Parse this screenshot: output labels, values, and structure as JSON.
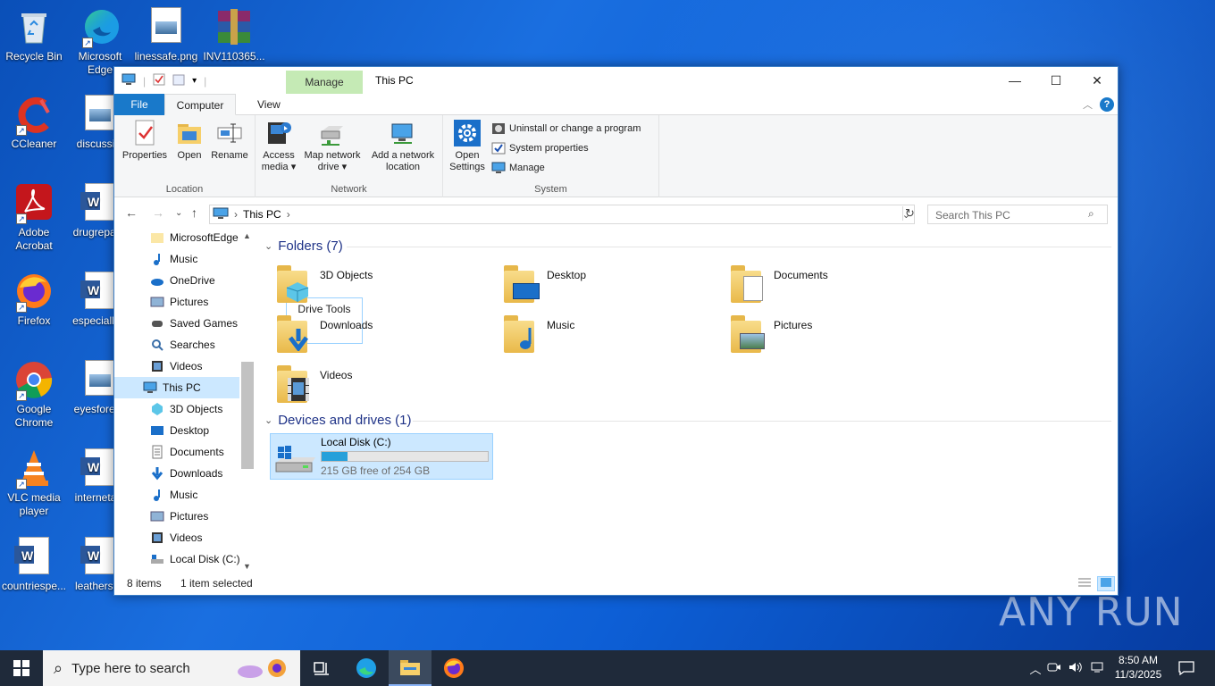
{
  "desktop": {
    "icons": [
      {
        "label": "Recycle Bin"
      },
      {
        "label": "Microsoft Edge"
      },
      {
        "label": "linessafe.png"
      },
      {
        "label": "INV110365..."
      },
      {
        "label": "CCleaner"
      },
      {
        "label": "discussi..."
      },
      {
        "label": "Adobe Acrobat"
      },
      {
        "label": "drugrepai..."
      },
      {
        "label": "Firefox"
      },
      {
        "label": "especially..."
      },
      {
        "label": "Google Chrome"
      },
      {
        "label": "eyesforei..."
      },
      {
        "label": "VLC media player"
      },
      {
        "label": "interneta..."
      },
      {
        "label": "countriespe..."
      },
      {
        "label": "leatherst..."
      }
    ],
    "watermark": "ANY RUN"
  },
  "window": {
    "title": "This PC",
    "contextual_tab": "Manage",
    "controls": {
      "minimize": "—",
      "maximize": "☐",
      "close": "✕"
    },
    "tabs": {
      "file": "File",
      "computer": "Computer",
      "view": "View",
      "drive_tools": "Drive Tools"
    },
    "ribbon": {
      "location": {
        "label": "Location",
        "properties": "Properties",
        "open": "Open",
        "rename": "Rename"
      },
      "network": {
        "label": "Network",
        "access_media_1": "Access",
        "access_media_2": "media ▾",
        "map_drive_1": "Map network",
        "map_drive_2": "drive ▾",
        "add_loc_1": "Add a network",
        "add_loc_2": "location"
      },
      "system": {
        "label": "System",
        "open_settings_1": "Open",
        "open_settings_2": "Settings",
        "uninstall": "Uninstall or change a program",
        "sys_props": "System properties",
        "manage": "Manage"
      }
    },
    "address": {
      "path": "This PC",
      "search_placeholder": "Search This PC"
    },
    "nav": [
      {
        "label": "MicrosoftEdge"
      },
      {
        "label": "Music"
      },
      {
        "label": "OneDrive"
      },
      {
        "label": "Pictures"
      },
      {
        "label": "Saved Games"
      },
      {
        "label": "Searches"
      },
      {
        "label": "Videos"
      },
      {
        "label": "This PC"
      },
      {
        "label": "3D Objects"
      },
      {
        "label": "Desktop"
      },
      {
        "label": "Documents"
      },
      {
        "label": "Downloads"
      },
      {
        "label": "Music"
      },
      {
        "label": "Pictures"
      },
      {
        "label": "Videos"
      },
      {
        "label": "Local Disk (C:)"
      }
    ],
    "folders_header": "Folders (7)",
    "folders": [
      {
        "label": "3D Objects"
      },
      {
        "label": "Desktop"
      },
      {
        "label": "Documents"
      },
      {
        "label": "Downloads"
      },
      {
        "label": "Music"
      },
      {
        "label": "Pictures"
      },
      {
        "label": "Videos"
      }
    ],
    "drives_header": "Devices and drives (1)",
    "drive": {
      "label": "Local Disk (C:)",
      "free_text": "215 GB free of 254 GB",
      "used_fraction": 0.154
    },
    "status": {
      "items": "8 items",
      "selected": "1 item selected"
    }
  },
  "taskbar": {
    "search_placeholder": "Type here to search",
    "clock_time": "8:50 AM",
    "clock_date": "11/3/2025"
  }
}
